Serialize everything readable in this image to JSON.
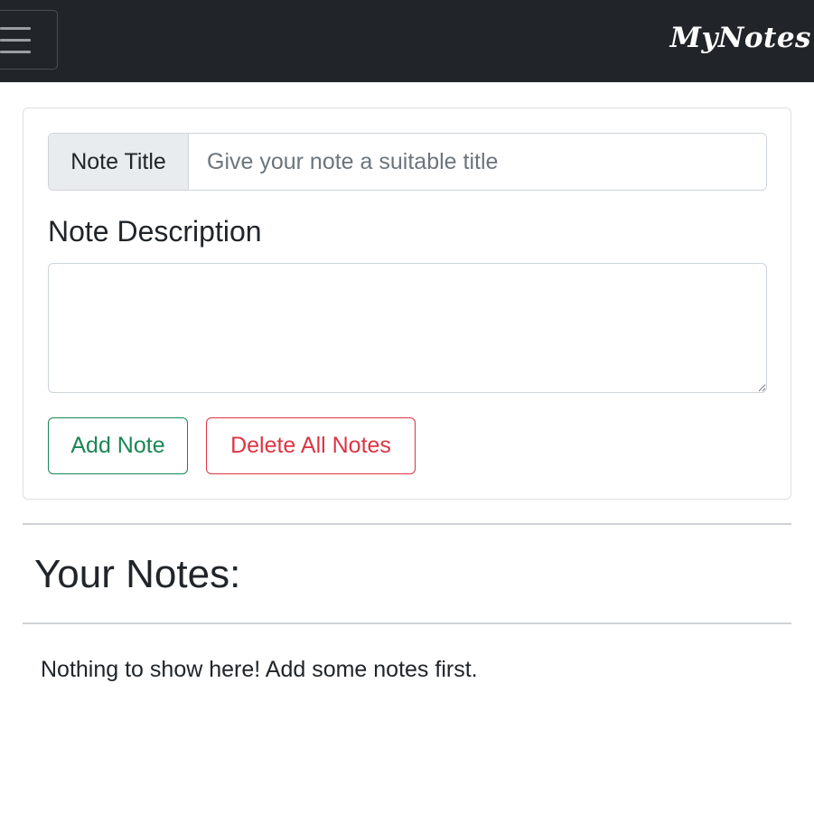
{
  "navbar": {
    "brand": "MyNotes",
    "toggle_icon": "hamburger-menu-icon"
  },
  "form": {
    "title_label": "Note Title",
    "title_placeholder": "Give your note a suitable title",
    "title_value": "",
    "description_label": "Note Description",
    "description_value": "",
    "add_button": "Add Note",
    "delete_all_button": "Delete All Notes"
  },
  "notes": {
    "heading": "Your Notes:",
    "empty_message": "Nothing to show here! Add some notes first."
  },
  "colors": {
    "navbar_bg": "#212529",
    "success": "#198754",
    "danger": "#dc3545"
  }
}
